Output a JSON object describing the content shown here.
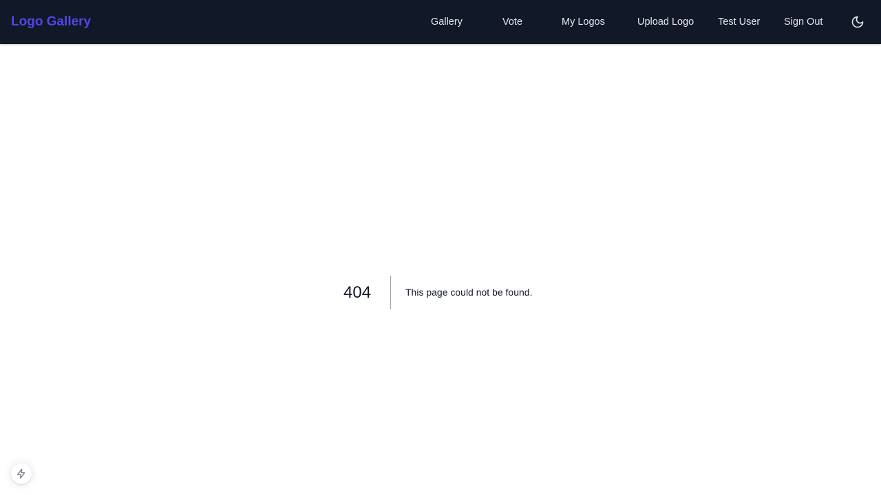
{
  "navbar": {
    "brand": "Logo Gallery",
    "links": {
      "gallery": "Gallery",
      "vote": "Vote",
      "my_logos": "My Logos",
      "upload_logo": "Upload Logo",
      "user": "Test User",
      "sign_out": "Sign Out"
    },
    "theme_toggle_icon": "moon-icon",
    "background_color": "#111827",
    "brand_color": "#4f46e5"
  },
  "error": {
    "code": "404",
    "message": "This page could not be found."
  },
  "dev_indicator": {
    "icon": "lightning-bolt-icon"
  }
}
